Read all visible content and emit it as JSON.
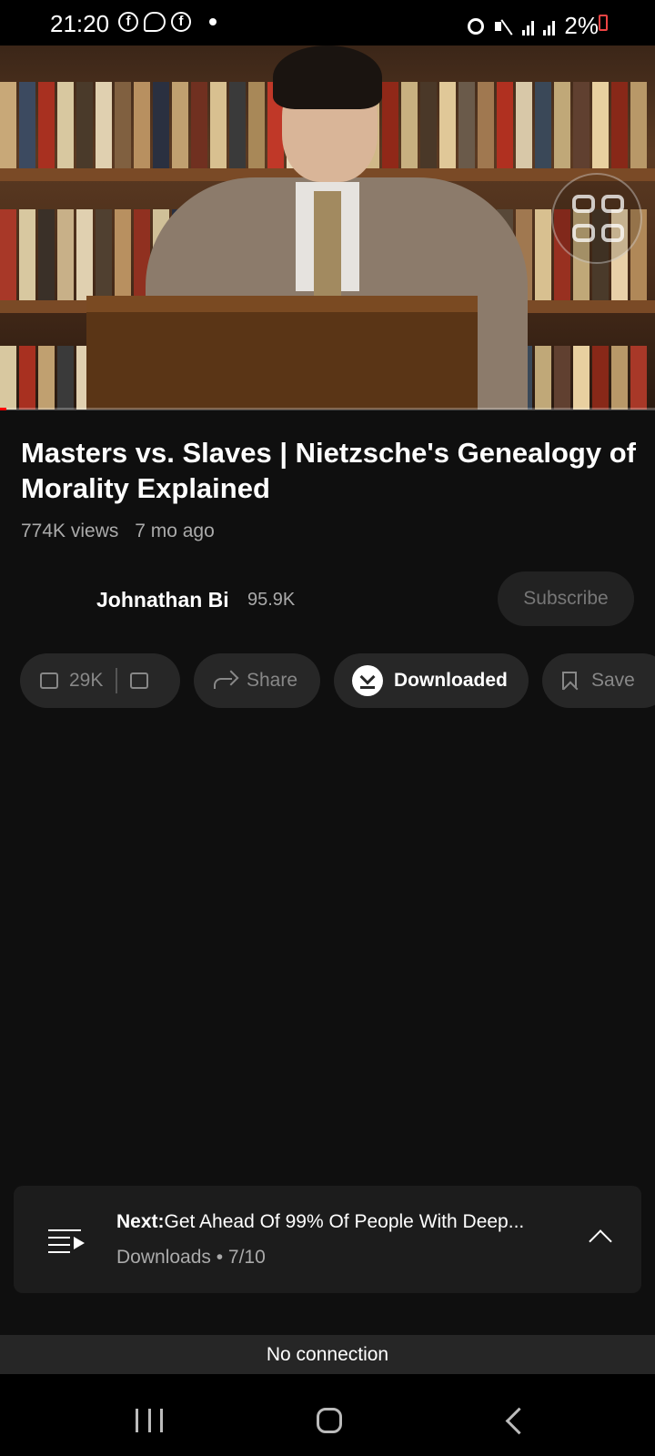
{
  "status_bar": {
    "time": "21:20",
    "battery": "2%",
    "left_icons": [
      "facebook-icon",
      "messenger-icon",
      "facebook-icon",
      "dot-icon"
    ],
    "right_icons": [
      "alarm-icon",
      "mute-icon",
      "signal-icon",
      "signal-icon",
      "battery-low-icon"
    ],
    "battery_color": "#ee4444"
  },
  "video": {
    "progress_percent": 1,
    "progress_color": "#ff0000"
  },
  "info": {
    "title": "Masters vs. Slaves | Nietzsche's Genealogy of Morality Explained",
    "views": "774K views",
    "age": "7 mo ago"
  },
  "channel": {
    "name": "Johnathan Bi",
    "subscribers": "95.9K",
    "subscribe_label": "Subscribe"
  },
  "actions": {
    "likes": "29K",
    "share": "Share",
    "downloaded": "Downloaded",
    "save": "Save"
  },
  "next": {
    "label": "Next:",
    "title": "Get Ahead Of 99% Of People With Deep...",
    "playlist": "Downloads • 7/10"
  },
  "connection": {
    "message": "No connection"
  }
}
